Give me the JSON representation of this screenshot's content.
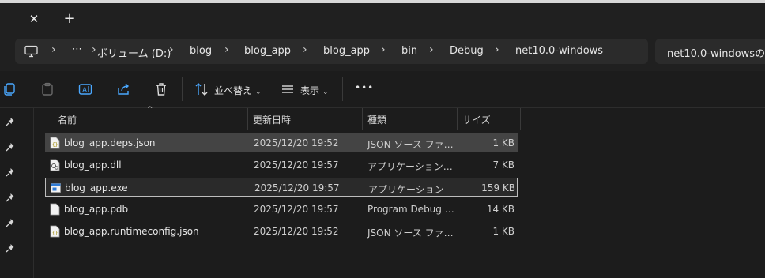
{
  "colors": {
    "background": "#1c1c1c",
    "selected_row": "#444444",
    "chrome": "#202020",
    "address_bg": "#2b2b2b"
  },
  "tabbar": {
    "close_icon": "close-icon",
    "close_glyph": "✕",
    "new_tab_icon": "plus-icon",
    "new_tab_glyph": "+"
  },
  "address": {
    "pc_icon": "monitor-icon",
    "more_glyph": "⋯",
    "breadcrumbs": [
      "ボリューム (D:)",
      "blog",
      "blog_app",
      "blog_app",
      "bin",
      "Debug",
      "net10.0-windows"
    ],
    "separator_glyph": "›",
    "search_placeholder": "net10.0-windowsの検"
  },
  "toolbar": {
    "copy_icon": "copy-icon",
    "paste_icon": "paste-icon",
    "rename_icon": "rename-icon",
    "share_icon": "share-icon",
    "delete_icon": "trash-icon",
    "sort_label": "並べ替え",
    "view_label": "表示",
    "more_glyph": "•••"
  },
  "nav": {
    "pin_icon": "pin-icon",
    "pin_count": 6
  },
  "table": {
    "columns": {
      "name": "名前",
      "date": "更新日時",
      "type": "種類",
      "size": "サイズ"
    },
    "sort_glyph": "^",
    "rows": [
      {
        "name": "blog_app.deps.json",
        "date": "2025/12/20 19:52",
        "type": "JSON ソース ファイル",
        "size": "1 KB",
        "icon": "json-file-icon"
      },
      {
        "name": "blog_app.dll",
        "date": "2025/12/20 19:57",
        "type": "アプリケーション拡張",
        "size": "7 KB",
        "icon": "dll-file-icon"
      },
      {
        "name": "blog_app.exe",
        "date": "2025/12/20 19:57",
        "type": "アプリケーション",
        "size": "159 KB",
        "icon": "exe-file-icon"
      },
      {
        "name": "blog_app.pdb",
        "date": "2025/12/20 19:57",
        "type": "Program Debug D...",
        "size": "14 KB",
        "icon": "file-icon"
      },
      {
        "name": "blog_app.runtimeconfig.json",
        "date": "2025/12/20 19:52",
        "type": "JSON ソース ファイル",
        "size": "1 KB",
        "icon": "json-file-icon"
      }
    ]
  }
}
